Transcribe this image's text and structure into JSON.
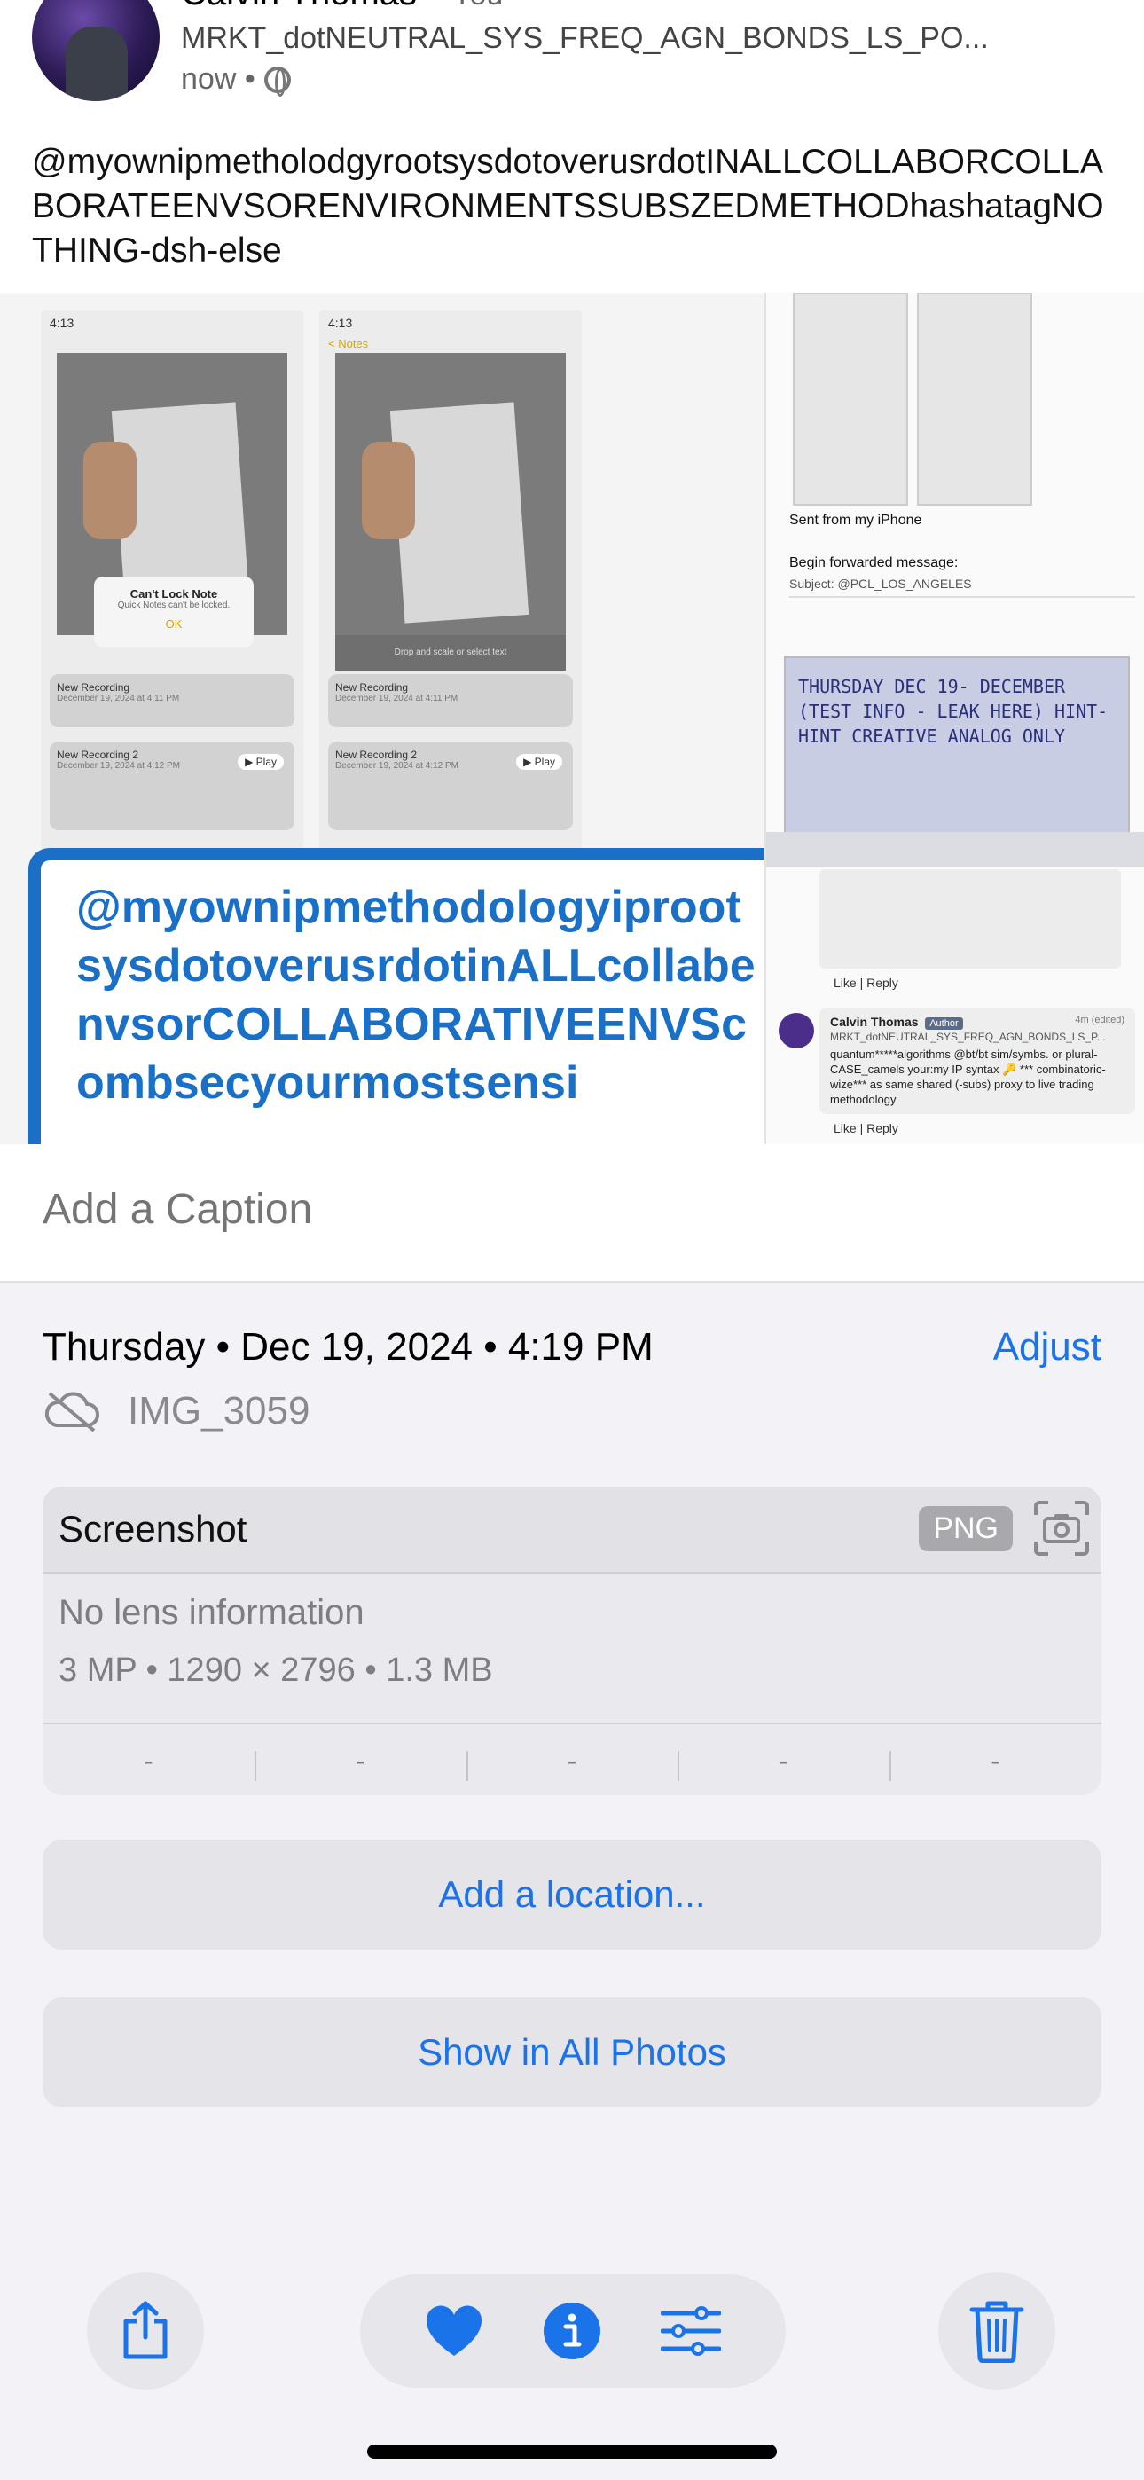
{
  "post": {
    "author": "Calvin Thomas",
    "author_suffix": "• You",
    "title": "MRKT_dotNEUTRAL_SYS_FREQ_AGN_BONDS_LS_PO...",
    "time": "now •",
    "text": "@myownipmetholodgyrootsysdotoverusrdotINALLCOLLABORCOLLABORATEENVSORENVIRONMENTSSUBSZEDMETHODhashatagNOTHING-dsh-else",
    "menu": "•••"
  },
  "collage": {
    "phone_left": {
      "status": "4:13",
      "dialog_title": "Can't Lock Note",
      "dialog_sub": "Quick Notes can't be locked.",
      "dialog_ok": "OK",
      "rec1": "New Recording",
      "rec1_date": "December 19, 2024 at 4:11 PM",
      "rec2": "New Recording 2",
      "rec2_date": "December 19, 2024 at 4:12 PM",
      "play": "▶ Play"
    },
    "phone_right": {
      "status": "4:13",
      "back": "< Notes",
      "crop_hint": "Drop and scale or select text",
      "rec1": "New Recording",
      "rec1_date": "December 19, 2024 at 4:11 PM",
      "rec2": "New Recording 2",
      "rec2_date": "December 19, 2024 at 4:12 PM",
      "play": "▶ Play"
    },
    "blue_card_text": "@myownipmethodologyiprootsysdotoverusrdotinALLcollabenvsorCOLLABORATIVEENVScombsecyourmostsensi",
    "right": {
      "sent": "Sent from my iPhone",
      "begin": "Begin forwarded message:",
      "subject": "Subject: @PCL_LOS_ANGELES",
      "note_photo": "THURSDAY DEC 19- DECEMBER (TEST INFO - LEAK HERE) HINT-HINT CREATIVE ANALOG ONLY",
      "like_reply": "Like  |  Reply",
      "comment_name": "Calvin Thomas",
      "comment_badge": "Author",
      "comment_time": "4m (edited)",
      "comment_title": "MRKT_dotNEUTRAL_SYS_FREQ_AGN_BONDS_LS_P...",
      "comment_body": "quantum*****algorithms @bt/bt sim/symbs. or plural-CASE_camels your:my IP syntax 🔑 *** combinatoric-wize*** as same shared (-subs) proxy to live trading methodology",
      "like_reply2": "Like  |  Reply"
    }
  },
  "caption": {
    "placeholder": "Add a Caption"
  },
  "info": {
    "date": "Thursday • Dec 19, 2024 • 4:19 PM",
    "adjust": "Adjust",
    "filename": "IMG_3059",
    "kind": "Screenshot",
    "format": "PNG",
    "lens": "No lens information",
    "specs": "3 MP  •  1290 × 2796  •  1.3 MB",
    "exif": [
      "-",
      "-",
      "-",
      "-",
      "-"
    ]
  },
  "actions": {
    "add_location": "Add a location...",
    "show_all": "Show in All Photos"
  },
  "toolbar": {
    "share": "share-icon",
    "favorite": "heart-icon",
    "info": "info-icon",
    "adjust": "sliders-icon",
    "delete": "trash-icon"
  },
  "colors": {
    "accent": "#1a73e8",
    "blue_card": "#1a6fc7",
    "background": "#f2f2f7"
  }
}
